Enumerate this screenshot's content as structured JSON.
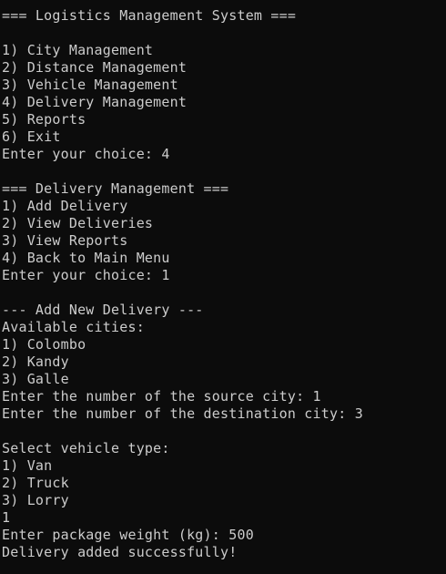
{
  "colors": {
    "background": "#0c0c0c",
    "foreground": "#cccccc"
  },
  "console": {
    "lines": [
      "=== Logistics Management System ===",
      "",
      "1) City Management",
      "2) Distance Management",
      "3) Vehicle Management",
      "4) Delivery Management",
      "5) Reports",
      "6) Exit",
      "Enter your choice: 4",
      "",
      "=== Delivery Management ===",
      "1) Add Delivery",
      "2) View Deliveries",
      "3) View Reports",
      "4) Back to Main Menu",
      "Enter your choice: 1",
      "",
      "--- Add New Delivery ---",
      "Available cities:",
      "1) Colombo",
      "2) Kandy",
      "3) Galle",
      "Enter the number of the source city: 1",
      "Enter the number of the destination city: 3",
      "",
      "Select vehicle type:",
      "1) Van",
      "2) Truck",
      "3) Lorry",
      "1",
      "Enter package weight (kg): 500",
      "Delivery added successfully!"
    ]
  }
}
